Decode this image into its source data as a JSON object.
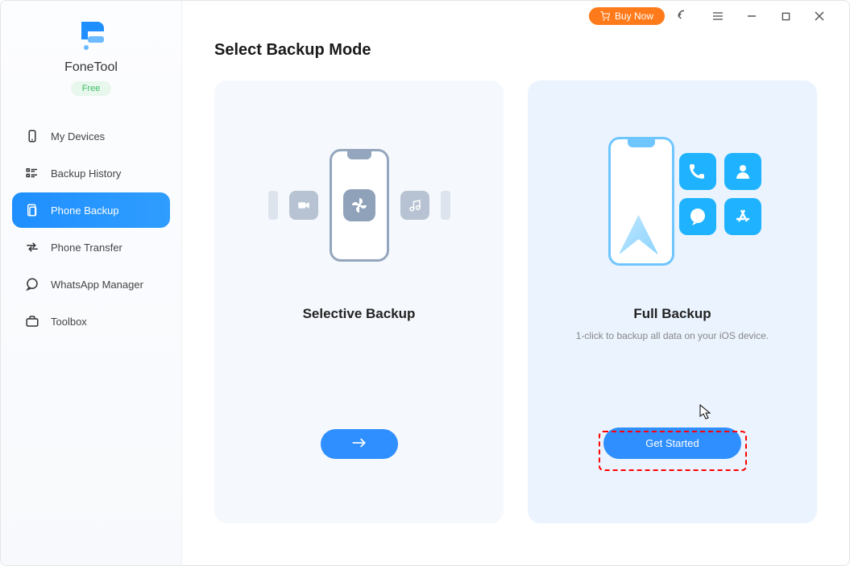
{
  "titlebar": {
    "buy_label": "Buy Now"
  },
  "brand": {
    "name": "FoneTool",
    "badge": "Free"
  },
  "sidebar": {
    "items": [
      {
        "label": "My Devices"
      },
      {
        "label": "Backup History"
      },
      {
        "label": "Phone Backup"
      },
      {
        "label": "Phone Transfer"
      },
      {
        "label": "WhatsApp Manager"
      },
      {
        "label": "Toolbox"
      }
    ]
  },
  "page": {
    "title": "Select Backup Mode"
  },
  "cards": {
    "selective": {
      "title": "Selective Backup",
      "subtitle": ""
    },
    "full": {
      "title": "Full Backup",
      "subtitle": "1-click to backup all data on your iOS device.",
      "button": "Get Started"
    }
  }
}
